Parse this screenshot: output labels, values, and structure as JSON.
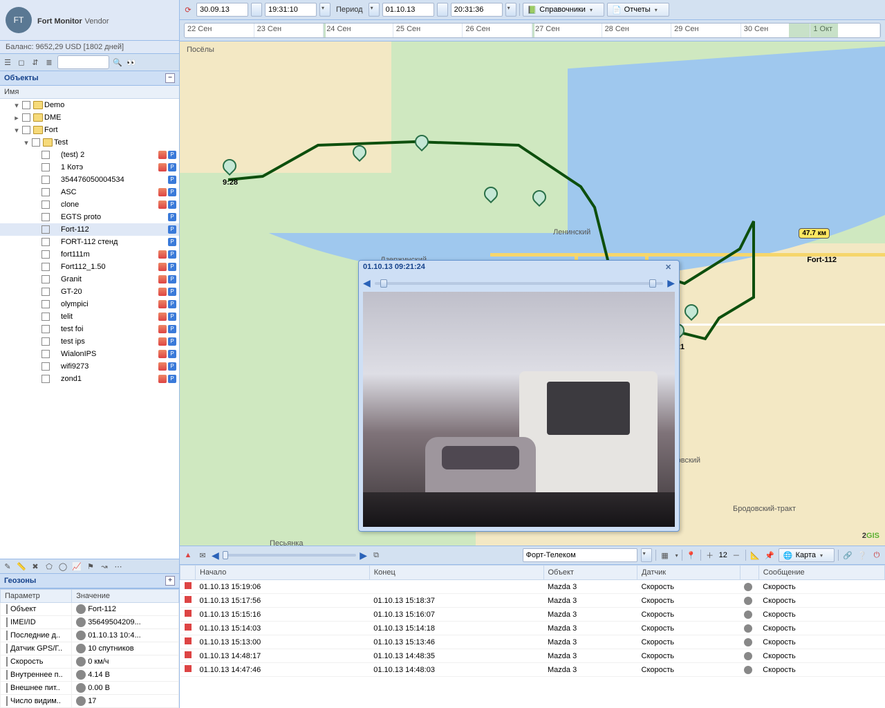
{
  "app": {
    "title_bold": "Fort Monitor",
    "title_light": "Vendor"
  },
  "balance": "Баланс: 9652,29 USD [1802 дней]",
  "objects_panel": {
    "title": "Объекты",
    "col": "Имя"
  },
  "search_placeholder": "",
  "tree": [
    {
      "indent": 1,
      "twisty": "▾",
      "folder": true,
      "label": "Demo",
      "status": []
    },
    {
      "indent": 1,
      "twisty": "▸",
      "folder": true,
      "label": "DME",
      "status": []
    },
    {
      "indent": 1,
      "twisty": "▾",
      "folder": true,
      "label": "Fort",
      "status": []
    },
    {
      "indent": 2,
      "twisty": "▾",
      "folder": true,
      "label": "Test",
      "status": []
    },
    {
      "indent": 3,
      "twisty": "",
      "folder": false,
      "label": "(test) 2",
      "status": [
        "wifi",
        "p"
      ]
    },
    {
      "indent": 3,
      "twisty": "",
      "folder": false,
      "label": "1 Котэ",
      "status": [
        "wifi",
        "p"
      ]
    },
    {
      "indent": 3,
      "twisty": "",
      "folder": false,
      "label": "354476050004534",
      "status": [
        "p"
      ]
    },
    {
      "indent": 3,
      "twisty": "",
      "folder": false,
      "label": "ASC",
      "status": [
        "wifi",
        "p"
      ]
    },
    {
      "indent": 3,
      "twisty": "",
      "folder": false,
      "label": "clone",
      "status": [
        "wifi",
        "p"
      ]
    },
    {
      "indent": 3,
      "twisty": "",
      "folder": false,
      "label": "EGTS proto",
      "status": [
        "p"
      ]
    },
    {
      "indent": 3,
      "twisty": "",
      "folder": false,
      "label": "Fort-112",
      "status": [
        "p"
      ],
      "sel": true
    },
    {
      "indent": 3,
      "twisty": "",
      "folder": false,
      "label": "FORT-112 стенд",
      "status": [
        "p"
      ]
    },
    {
      "indent": 3,
      "twisty": "",
      "folder": false,
      "label": "fort111m",
      "status": [
        "wifi",
        "p"
      ]
    },
    {
      "indent": 3,
      "twisty": "",
      "folder": false,
      "label": "Fort112_1.50",
      "status": [
        "wifi",
        "p"
      ]
    },
    {
      "indent": 3,
      "twisty": "",
      "folder": false,
      "label": "Granit",
      "status": [
        "wifi",
        "p"
      ]
    },
    {
      "indent": 3,
      "twisty": "",
      "folder": false,
      "label": "GT-20",
      "status": [
        "wifi",
        "p"
      ]
    },
    {
      "indent": 3,
      "twisty": "",
      "folder": false,
      "label": "olympici",
      "status": [
        "wifi",
        "p"
      ]
    },
    {
      "indent": 3,
      "twisty": "",
      "folder": false,
      "label": "telit",
      "status": [
        "wifi",
        "p"
      ]
    },
    {
      "indent": 3,
      "twisty": "",
      "folder": false,
      "label": "test foi",
      "status": [
        "wifi",
        "p"
      ]
    },
    {
      "indent": 3,
      "twisty": "",
      "folder": false,
      "label": "test ips",
      "status": [
        "wifi",
        "p"
      ]
    },
    {
      "indent": 3,
      "twisty": "",
      "folder": false,
      "label": "WialonIPS",
      "status": [
        "wifi",
        "p"
      ]
    },
    {
      "indent": 3,
      "twisty": "",
      "folder": false,
      "label": "wifi9273",
      "status": [
        "wifi",
        "p"
      ]
    },
    {
      "indent": 3,
      "twisty": "",
      "folder": false,
      "label": "zond1",
      "status": [
        "wifi",
        "p"
      ]
    }
  ],
  "geozones": {
    "title": "Геозоны"
  },
  "params": {
    "cols": [
      "Параметр",
      "Значение"
    ],
    "rows": [
      {
        "k": "Объект",
        "v": "Fort-112"
      },
      {
        "k": "IMEI/ID",
        "v": "35649504209..."
      },
      {
        "k": "Последние д..",
        "v": "01.10.13 10:4..."
      },
      {
        "k": "Датчик GPS/Г..",
        "v": "10 спутников"
      },
      {
        "k": "Скорость",
        "v": "0 км/ч"
      },
      {
        "k": "Внутреннее п..",
        "v": "4.14 В"
      },
      {
        "k": "Внешнее пит..",
        "v": "0.00 В"
      },
      {
        "k": "Число видим..",
        "v": "17"
      }
    ]
  },
  "top_toolbar": {
    "date_from": "30.09.13",
    "time_from": "19:31:10",
    "period_label": "Период",
    "date_to": "01.10.13",
    "time_to": "20:31:36",
    "dict_label": "Справочники",
    "reports_label": "Отчеты"
  },
  "timeline": [
    "22 Сен",
    "23 Сен",
    "24 Сен",
    "25 Сен",
    "26 Сен",
    "27 Сен",
    "28 Сен",
    "29 Сен",
    "30 Сен",
    "1 Окт"
  ],
  "map": {
    "vehicle_name": "Fort-112",
    "badge": "47.7 км",
    "labels": {
      "l1": "Дзержинский",
      "l2": "Ленинский",
      "l3": "Свердловский",
      "l4": "Песьянка",
      "l5": "Посёлы",
      "l6": "Бродовский-тракт"
    },
    "stop1": "9:28",
    "stop2": "1:21",
    "attr_num": "2",
    "attr_txt": "GIS"
  },
  "photo": {
    "title": "01.10.13 09:21:24"
  },
  "bottom_tb": {
    "company": "Форт-Телеком",
    "zoom": "12",
    "map_btn": "Карта"
  },
  "events": {
    "cols": [
      "",
      "Начало",
      "Конец",
      "Объект",
      "Датчик",
      "",
      "Сообщение"
    ],
    "rows": [
      {
        "start": "01.10.13 15:19:06",
        "end": "",
        "obj": "Mazda 3",
        "sensor": "Скорость",
        "msg": "Скорость"
      },
      {
        "start": "01.10.13 15:17:56",
        "end": "01.10.13 15:18:37",
        "obj": "Mazda 3",
        "sensor": "Скорость",
        "msg": "Скорость"
      },
      {
        "start": "01.10.13 15:15:16",
        "end": "01.10.13 15:16:07",
        "obj": "Mazda 3",
        "sensor": "Скорость",
        "msg": "Скорость"
      },
      {
        "start": "01.10.13 15:14:03",
        "end": "01.10.13 15:14:18",
        "obj": "Mazda 3",
        "sensor": "Скорость",
        "msg": "Скорость"
      },
      {
        "start": "01.10.13 15:13:00",
        "end": "01.10.13 15:13:46",
        "obj": "Mazda 3",
        "sensor": "Скорость",
        "msg": "Скорость"
      },
      {
        "start": "01.10.13 14:48:17",
        "end": "01.10.13 14:48:35",
        "obj": "Mazda 3",
        "sensor": "Скорость",
        "msg": "Скорость"
      },
      {
        "start": "01.10.13 14:47:46",
        "end": "01.10.13 14:48:03",
        "obj": "Mazda 3",
        "sensor": "Скорость",
        "msg": "Скорость"
      }
    ]
  }
}
